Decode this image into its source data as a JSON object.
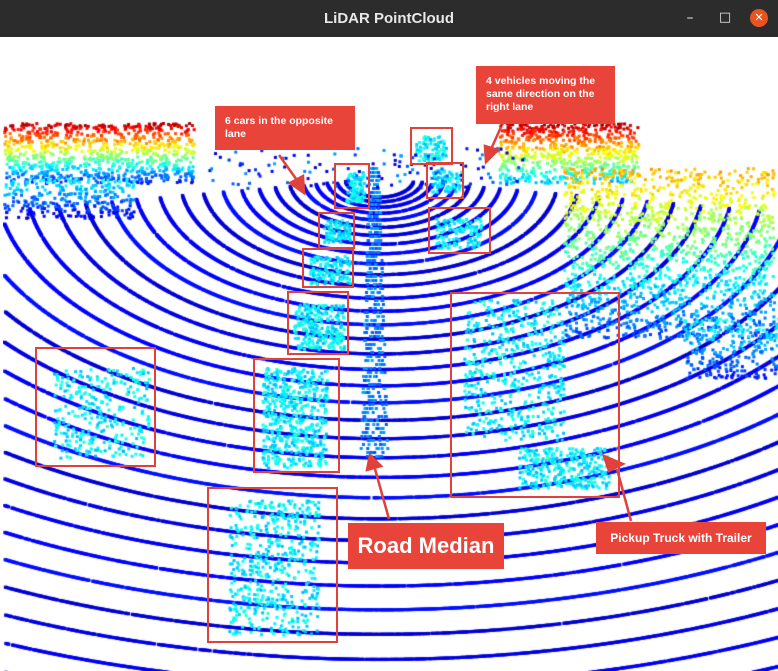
{
  "window": {
    "title": "LiDAR PointCloud",
    "controls": {
      "minimize": "–",
      "maximize": "□",
      "close": "✕"
    }
  },
  "annotations": {
    "opposite_lane": "6 cars in the opposite lane",
    "same_direction": "4 vehicles moving the same direction on the right lane",
    "road_median": "Road Median",
    "pickup_truck": "Pickup Truck with Trailer"
  },
  "colors": {
    "titlebar": "#2c2c2c",
    "annotation_red": "#e8443a",
    "close_button": "#e95420"
  },
  "scene": {
    "colormap": "jet",
    "opposite_lane_car_boxes": 6,
    "same_direction_vehicle_boxes": 4
  }
}
